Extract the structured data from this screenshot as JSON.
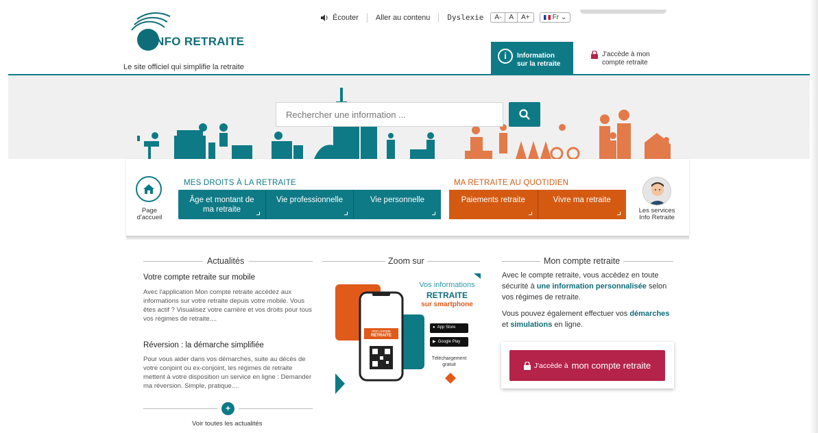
{
  "header": {
    "logo_text": "INFO RETRAITE",
    "tagline": "Le site officiel qui simplifie la retraite",
    "listen": "Écouter",
    "skip": "Aller au contenu",
    "dyslexia": "Dyslexie",
    "size_minus": "A-",
    "size_normal": "A",
    "size_plus": "A+",
    "language": "Fr",
    "info_tab": "Information sur la retraite",
    "info_tab_line1": "Information",
    "info_tab_line2": "sur la retraite",
    "account_link_line1": "J'accède à mon",
    "account_link_line2": "compte retraite"
  },
  "search": {
    "placeholder": "Rechercher une information ..."
  },
  "nav": {
    "home_line1": "Page",
    "home_line2": "d'accueil",
    "droits_title": "MES DROITS À LA RETRAITE",
    "quotidien_title": "MA RETRAITE AU QUOTIDIEN",
    "droits_items": [
      "Âge et montant de",
      "ma retraite",
      "Vie professionnelle",
      "Vie personnelle"
    ],
    "quotidien_items": [
      "Paiements retraite",
      "Vivre ma retraite"
    ],
    "services_line1": "Les services",
    "services_line2": "Info Retraite"
  },
  "actualites": {
    "title": "Actualités",
    "item1_title": "Votre compte retraite sur mobile",
    "item1_body": "Avec l'application Mon compte retraite accédez aux informations sur votre retraite depuis votre mobile. Vous êtes actif ?   Visualisez votre carrière et vos droits pour tous vos régimes de retraite....",
    "item2_title": "Réversion : la démarche simplifiée",
    "item2_body": "Pour vous aider dans vos démarches, suite au décès de votre conjoint ou ex-conjoint, les régimes de retraite mettent à votre disposition un service en ligne : Demander ma réversion.   Simple, pratique....",
    "more_label": "Voir toutes les actualités"
  },
  "zoom": {
    "title": "Zoom sur",
    "promo_line1": "Vos informations",
    "promo_line2": "RETRAITE",
    "promo_line3": "sur smartphone",
    "app_store": "App Store",
    "google_play": "Google Play",
    "download_line1": "Téléchargement",
    "download_line2": "gratuit",
    "phone_brand_line1": "mon compte",
    "phone_brand_line2": "RETRAITE"
  },
  "compte": {
    "title": "Mon compte retraite",
    "p1_a": "Avec le compte retraite, vous accédez en toute sécurité à ",
    "p1_b": "une information personnalisée",
    "p1_c": " selon vos régimes de retraite.",
    "p2_a": "Vous pouvez également effectuer vos ",
    "p2_b": "démarches",
    "p2_c": " et ",
    "p2_d": "simulations",
    "p2_e": " en ligne.",
    "button_small": "J'accède à",
    "button_big": "mon compte retraite"
  },
  "colors": {
    "teal": "#0e7a86",
    "orange": "#d45a12",
    "crimson": "#b5224a"
  },
  "icons": [
    "speaker-icon",
    "info-icon",
    "lock-icon",
    "search-icon",
    "home-icon",
    "plus-icon",
    "apple-icon",
    "play-icon"
  ]
}
